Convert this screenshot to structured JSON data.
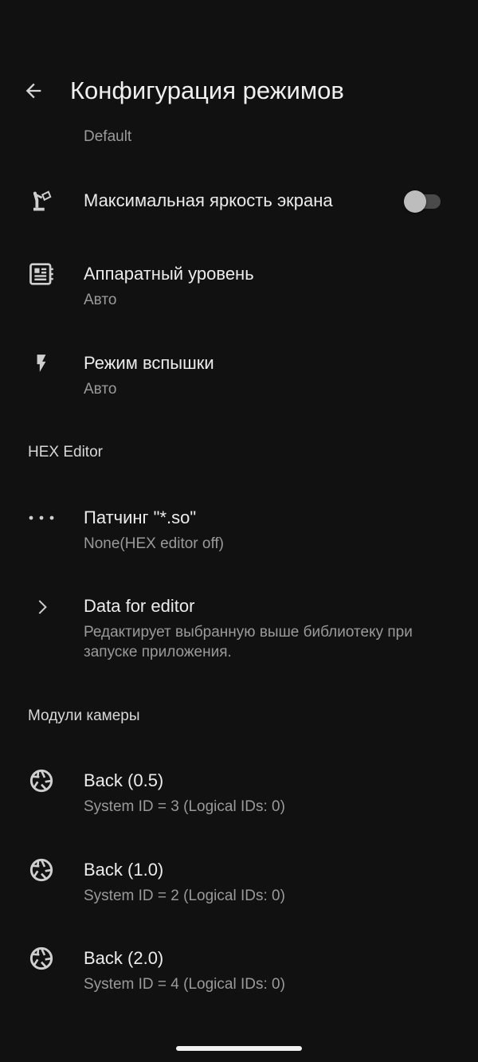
{
  "header": {
    "title": "Конфигурация режимов",
    "back_icon": "arrow-back-icon"
  },
  "top_subtitle": "Default",
  "settings": {
    "max_brightness": {
      "title": "Максимальная яркость экрана",
      "icon": "lamp-icon",
      "enabled": false
    },
    "hardware_level": {
      "title": "Аппаратный уровень",
      "value": "Авто",
      "icon": "hardware-board-icon"
    },
    "flash_mode": {
      "title": "Режим вспышки",
      "value": "Авто",
      "icon": "flash-icon"
    }
  },
  "hex_section": {
    "header": "HEX Editor",
    "patching": {
      "title": "Патчинг \"*.so\"",
      "value": "None(HEX editor off)",
      "icon": "more-dots-icon"
    },
    "data_for_editor": {
      "title": "Data for editor",
      "description": "Редактирует выбранную выше библиотеку при запуске приложения.",
      "icon": "chevron-right-icon"
    }
  },
  "camera_section": {
    "header": "Модули камеры",
    "modules": [
      {
        "title": "Back  (0.5)",
        "subtitle": "System ID = 3  (Logical IDs:  0)",
        "icon": "camera-aperture-icon"
      },
      {
        "title": "Back  (1.0)",
        "subtitle": "System ID = 2  (Logical IDs:  0)",
        "icon": "camera-aperture-icon"
      },
      {
        "title": "Back  (2.0)",
        "subtitle": "System ID = 4  (Logical IDs:  0)",
        "icon": "camera-aperture-icon"
      }
    ]
  },
  "colors": {
    "background": "#111111",
    "text_primary": "#ececec",
    "text_secondary": "#9a9a9a",
    "toggle_off_track": "#4a4a4a",
    "toggle_off_thumb": "#bdbdbd"
  }
}
